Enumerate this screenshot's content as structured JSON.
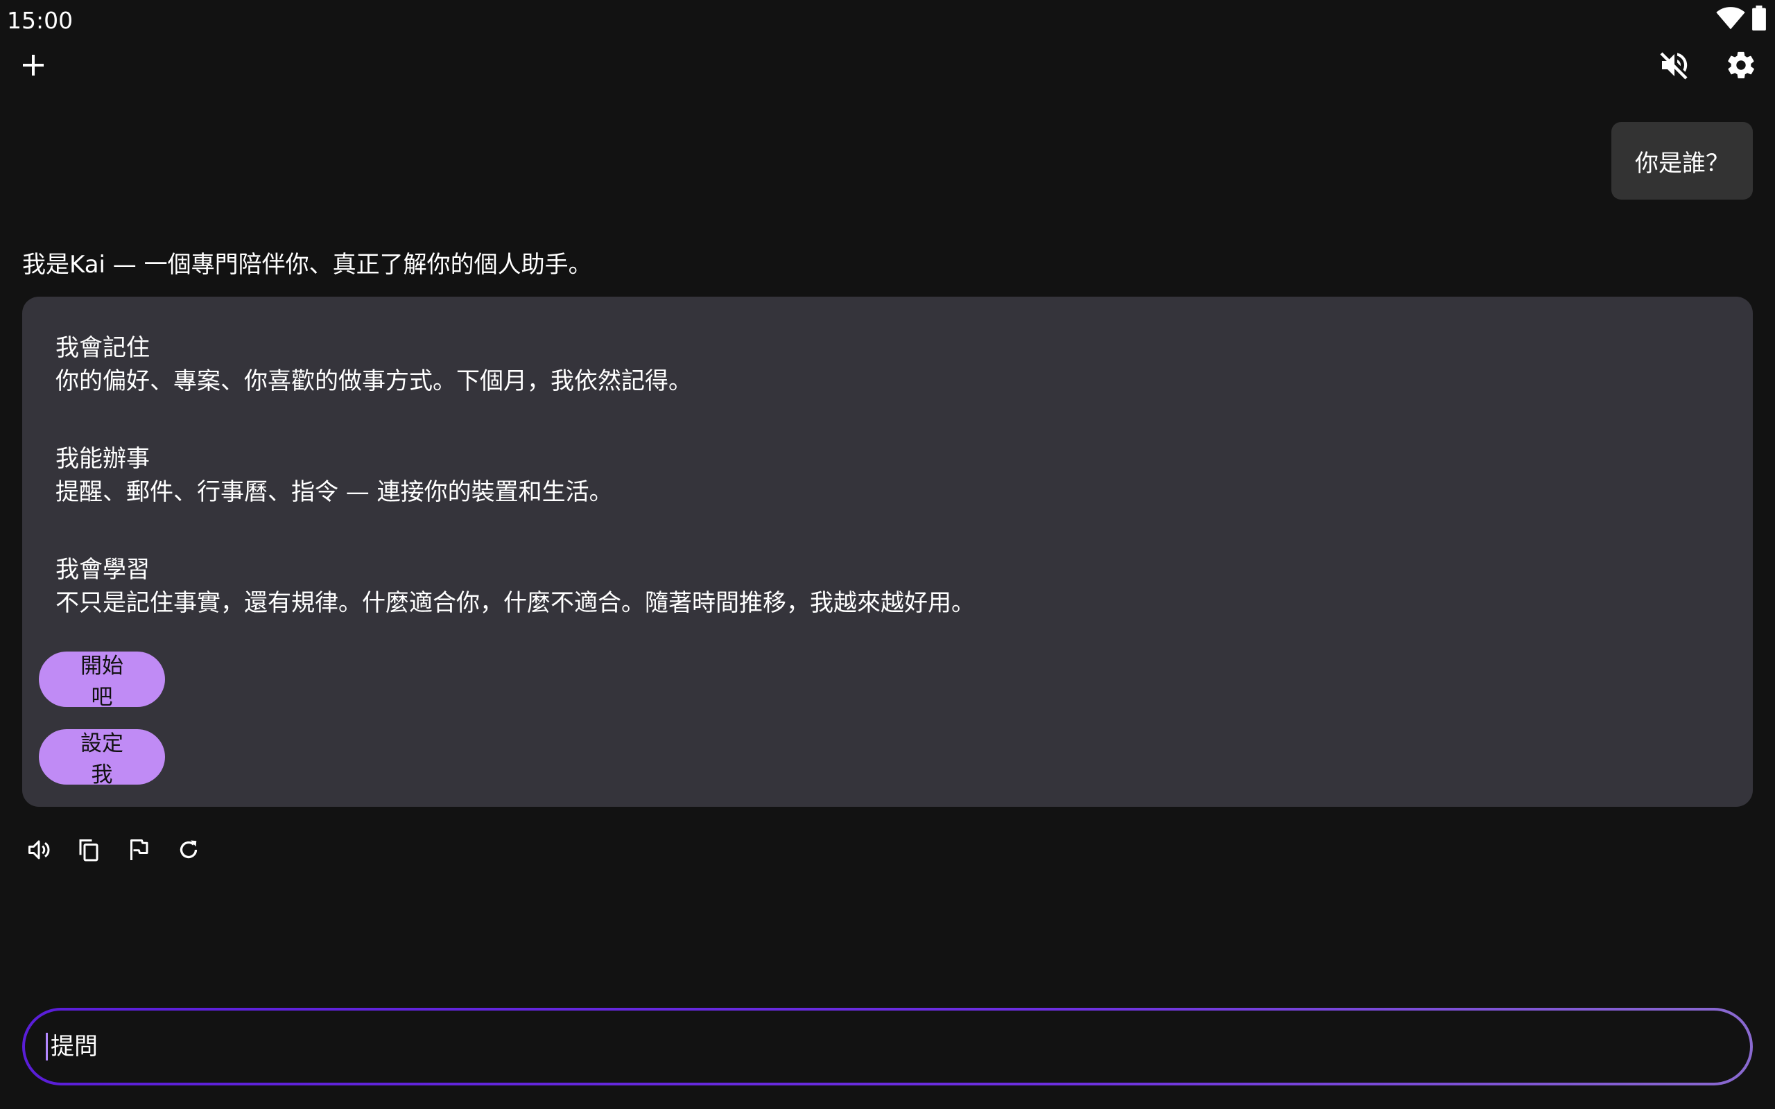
{
  "status_bar": {
    "time": "15:00",
    "icons": [
      "wifi-icon",
      "battery-icon"
    ]
  },
  "toolbar": {
    "new_chat_icon": "plus-icon",
    "mute_icon": "volume-off-icon",
    "settings_icon": "gear-icon"
  },
  "chat": {
    "user_message": "你是誰？",
    "assistant_intro": "我是Kai — 一個專門陪伴你、真正了解你的個人助手。",
    "card": {
      "sections": [
        {
          "heading": "我會記住",
          "body": "你的偏好、專案、你喜歡的做事方式。下個月，我依然記得。"
        },
        {
          "heading": "我能辦事",
          "body": "提醒、郵件、行事曆、指令 — 連接你的裝置和生活。"
        },
        {
          "heading": "我會學習",
          "body": "不只是記住事實，還有規律。什麼適合你，什麼不適合。隨著時間推移，我越來越好用。"
        }
      ],
      "buttons": [
        {
          "label": "開始吧"
        },
        {
          "label": "設定我"
        }
      ]
    },
    "actions": [
      "speaker-icon",
      "copy-icon",
      "flag-icon",
      "refresh-icon"
    ]
  },
  "composer": {
    "placeholder": "提問",
    "value": ""
  },
  "colors": {
    "background": "#121212",
    "card": "#35343b",
    "user_bubble": "#333333",
    "accent_button": "#c08bf5",
    "input_border_start": "#5a1ed8",
    "input_border_end": "#8a6ad0"
  }
}
